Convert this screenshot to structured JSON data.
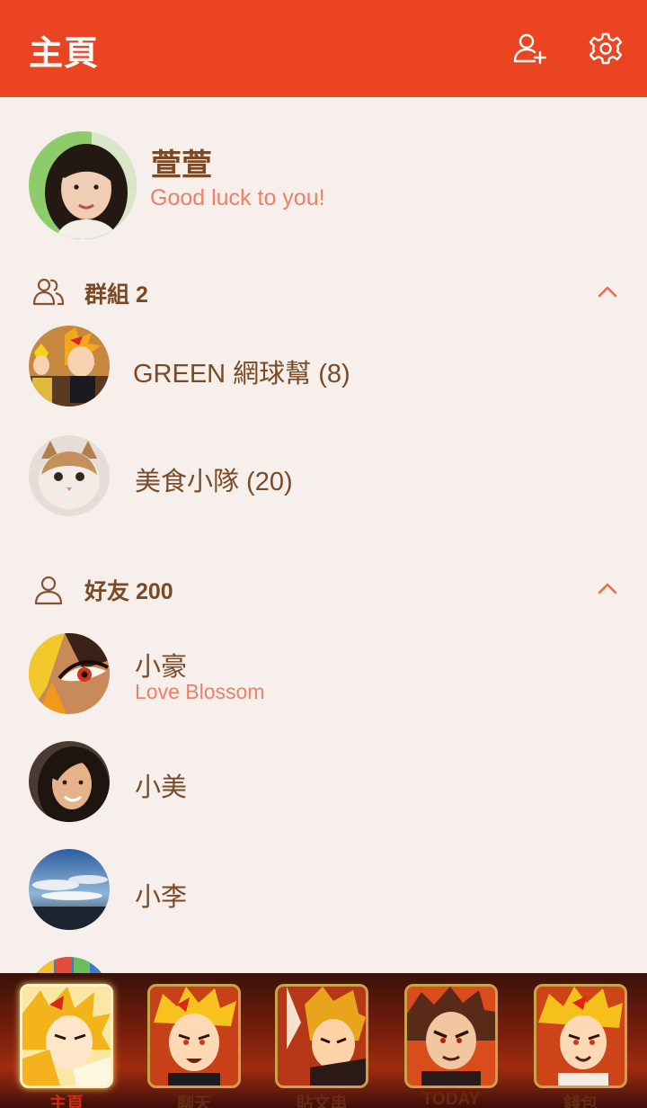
{
  "header": {
    "title": "主頁"
  },
  "profile": {
    "name": "萱萱",
    "status": "Good luck to you!"
  },
  "groups": {
    "label": "群組 2",
    "items": [
      {
        "name": "GREEN 網球幫 (8)"
      },
      {
        "name": "美食小隊 (20)"
      }
    ]
  },
  "friends": {
    "label": "好友 200",
    "items": [
      {
        "name": "小豪",
        "status": "Love Blossom"
      },
      {
        "name": "小美"
      },
      {
        "name": "小李"
      }
    ]
  },
  "tabs": [
    {
      "label": "主頁",
      "active": true
    },
    {
      "label": "聊天"
    },
    {
      "label": "貼文串"
    },
    {
      "label": "TODAY"
    },
    {
      "label": "錢包"
    }
  ],
  "colors": {
    "header": "#ea4422",
    "background": "#f7efeb",
    "text": "#7a4a26",
    "accent": "#ef7f66"
  },
  "icons": [
    "add-friend-icon",
    "settings-icon",
    "group-icon",
    "friend-icon",
    "chevron-up-icon"
  ]
}
